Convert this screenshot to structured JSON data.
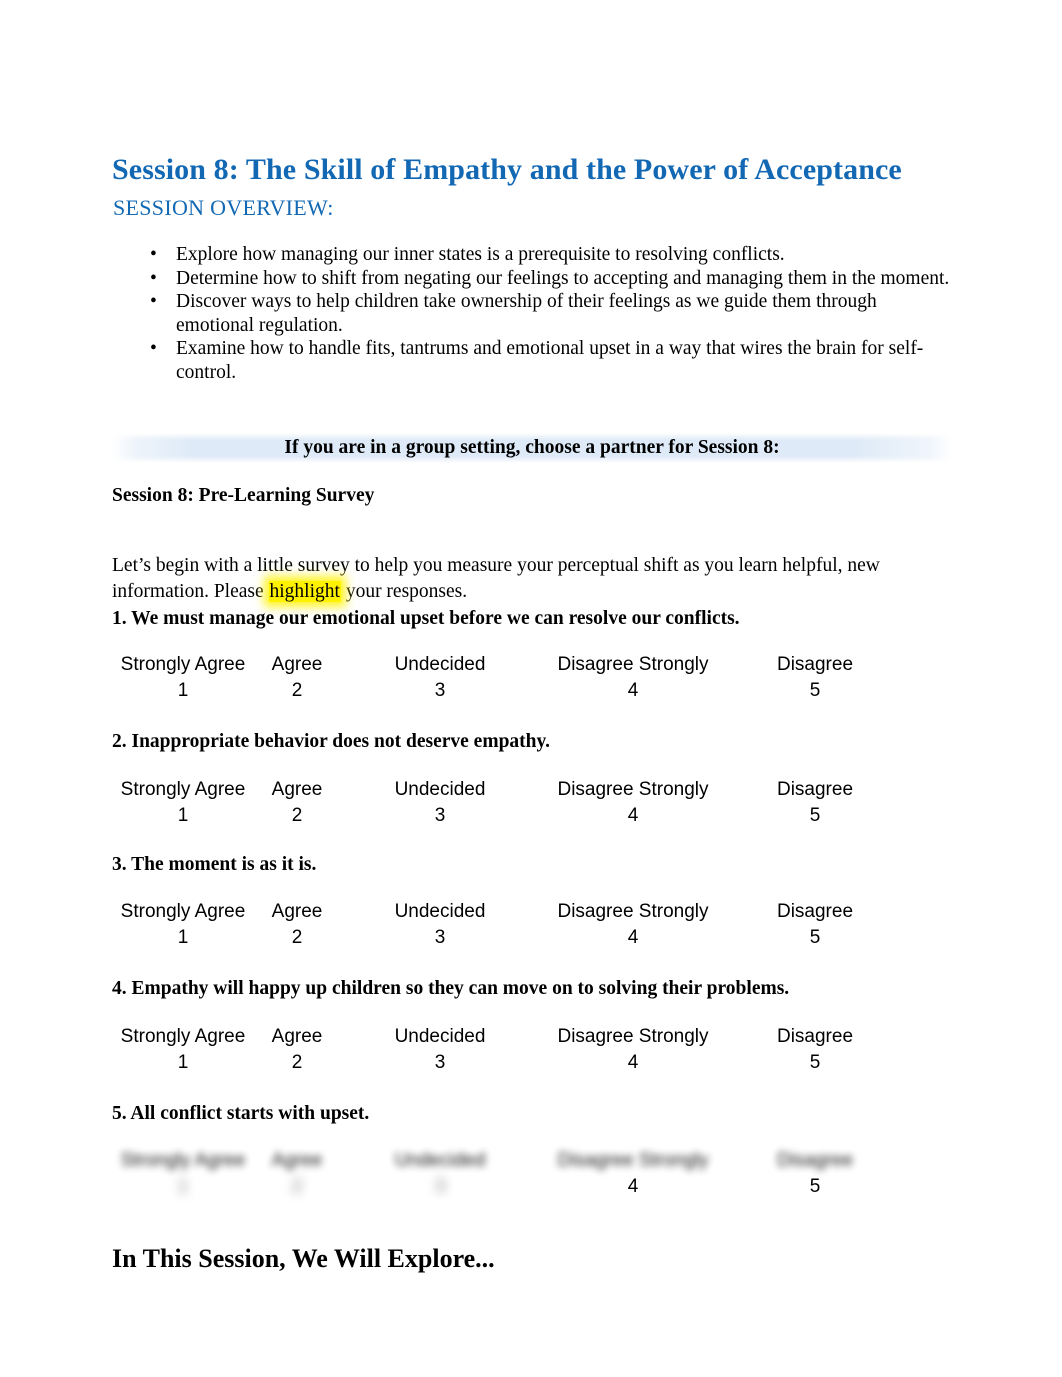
{
  "document": {
    "title": "Session 8: The Skill of Empathy and the Power of Acceptance",
    "title_color": "#1268b3",
    "overview_heading": "SESSION OVERVIEW:",
    "overview_bullets": [
      "Explore how managing our inner states is a prerequisite to resolving conflicts.",
      "Determine how to shift from negating our feelings to accepting and managing them in the moment.",
      "Discover ways to help children take ownership of their feelings as we guide them through emotional regulation.",
      "Examine how to handle fits, tantrums and emotional upset in a way that wires the brain for self-control."
    ],
    "bullet_glyph": "•",
    "banner": {
      "text": "If you are in a group setting, choose a partner for Session 8:",
      "background_color": "#deeaf7"
    },
    "survey_heading": "Session 8: Pre-Learning Survey",
    "intro": {
      "before_highlight": "Let’s begin with a little survey to help you measure your perceptual shift as you learn helpful, new information. Please ",
      "highlighted_word": "highlight",
      "after_highlight": " your responses.",
      "highlight_color": "#fff200"
    },
    "scale": {
      "labels": [
        "Strongly Agree",
        "Agree",
        "Undecided",
        "Disagree Strongly",
        "Disagree"
      ],
      "numbers": [
        "1",
        "2",
        "3",
        "4",
        "5"
      ]
    },
    "questions": [
      "1. We must manage our emotional upset before we can resolve our conflicts.",
      "2. Inappropriate behavior does not deserve empathy.",
      "3. The moment is as it is.",
      "4. Empathy will happy up children so they can move on to solving their problems.",
      "5. All conflict starts with upset."
    ],
    "closing_heading": "In This Session, We Will Explore..."
  }
}
